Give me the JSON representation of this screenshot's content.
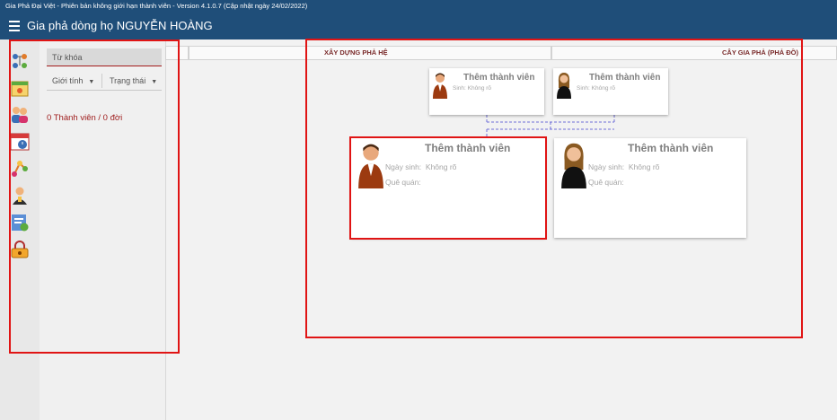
{
  "window": {
    "title": "Gia Phả Đại Việt - Phiên bản không giới hạn thành viên - Version 4.1.0.7 (Cập nhật ngày 24/02/2022)"
  },
  "header": {
    "title": "Gia phả dòng họ NGUYỄN HOÀNG",
    "menu_icon": "hamburger-menu-icon"
  },
  "toolbar": {
    "items": [
      {
        "icon": "family-tree-icon"
      },
      {
        "icon": "calendar-event-icon"
      },
      {
        "icon": "couple-icon"
      },
      {
        "icon": "calendar-clock-icon"
      },
      {
        "icon": "connections-icon"
      },
      {
        "icon": "person-info-icon"
      },
      {
        "icon": "document-settings-icon"
      },
      {
        "icon": "lock-account-icon"
      }
    ]
  },
  "left_panel": {
    "search_placeholder": "Từ khóa",
    "filters": {
      "gender": "Giới tính",
      "status": "Trạng thái"
    },
    "member_count": "0 Thành viên / 0 đời"
  },
  "tabs": {
    "build": "XÂY DỰNG PHẢ HỆ",
    "tree": "CÂY GIA PHẢ (PHẢ ĐỒ)"
  },
  "tree": {
    "father": {
      "name": "Thêm thành viên",
      "birth_label": "Sinh:",
      "birth_value": "Không rõ"
    },
    "mother": {
      "name": "Thêm thành viên",
      "birth_label": "Sinh:",
      "birth_value": "Không rõ"
    },
    "self": {
      "name": "Thêm thành viên",
      "birth_label": "Ngày sinh:",
      "birth_value": "Không rõ",
      "hometown_label": "Quê quán:"
    },
    "spouse": {
      "name": "Thêm thành viên",
      "birth_label": "Ngày sinh:",
      "birth_value": "Không rõ",
      "hometown_label": "Quê quán:"
    }
  },
  "colors": {
    "header_bg": "#1f4e79",
    "accent_red": "#e01414",
    "member_count_text": "#9e1b1b",
    "connector": "#7070d8"
  }
}
